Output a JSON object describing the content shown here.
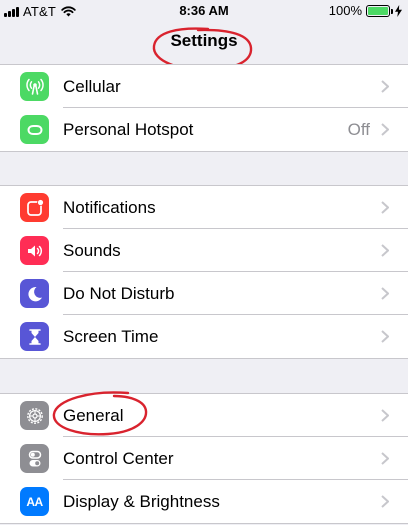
{
  "status_bar": {
    "carrier": "AT&T",
    "time": "8:36 AM",
    "battery_percent": "100%",
    "battery_level": 1.0
  },
  "nav": {
    "title": "Settings"
  },
  "colors": {
    "green": "#4cd964",
    "red": "#ff3b30",
    "pink": "#ff2d55",
    "purple": "#5856d6",
    "gray": "#8e8e93",
    "blue": "#007aff",
    "annotation": "#d9232e"
  },
  "groups": [
    {
      "rows": [
        {
          "label": "Cellular",
          "value": "",
          "icon": "cellular-antenna-icon"
        },
        {
          "label": "Personal Hotspot",
          "value": "Off",
          "icon": "hotspot-link-icon"
        }
      ]
    },
    {
      "rows": [
        {
          "label": "Notifications",
          "value": "",
          "icon": "notifications-icon"
        },
        {
          "label": "Sounds",
          "value": "",
          "icon": "speaker-icon"
        },
        {
          "label": "Do Not Disturb",
          "value": "",
          "icon": "moon-icon"
        },
        {
          "label": "Screen Time",
          "value": "",
          "icon": "hourglass-icon"
        }
      ]
    },
    {
      "rows": [
        {
          "label": "General",
          "value": "",
          "icon": "gear-icon"
        },
        {
          "label": "Control Center",
          "value": "",
          "icon": "toggles-icon"
        },
        {
          "label": "Display & Brightness",
          "value": "",
          "icon": "text-size-icon",
          "icon_text": "AA"
        }
      ]
    }
  ]
}
